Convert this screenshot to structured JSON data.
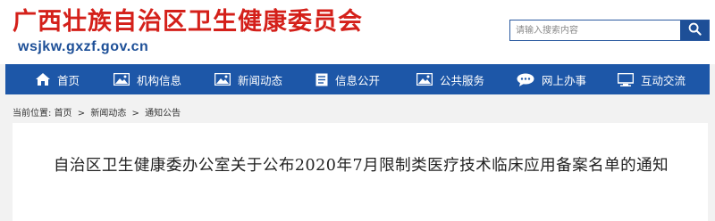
{
  "header": {
    "site_title": "广西壮族自治区卫生健康委员会",
    "site_url": "wsjkw.gxzf.gov.cn"
  },
  "search": {
    "placeholder": "请输入搜索内容",
    "icon": "search-icon"
  },
  "nav": {
    "items": [
      {
        "label": "首页",
        "icon": "home-icon"
      },
      {
        "label": "机构信息",
        "icon": "image-icon"
      },
      {
        "label": "新闻动态",
        "icon": "image-icon"
      },
      {
        "label": "信息公开",
        "icon": "document-icon"
      },
      {
        "label": "公共服务",
        "icon": "image-icon"
      },
      {
        "label": "网上办事",
        "icon": "chat-icon"
      },
      {
        "label": "互动交流",
        "icon": "monitor-icon"
      }
    ]
  },
  "breadcrumb": {
    "prefix": "当前位置:",
    "items": [
      "首页",
      "新闻动态",
      "通知公告"
    ],
    "separator": ">"
  },
  "article": {
    "title": "自治区卫生健康委办公室关于公布2020年7月限制类医疗技术临床应用备案名单的通知"
  },
  "colors": {
    "brand_red": "#d4201a",
    "brand_blue": "#1d57a8",
    "page_bg": "#f2f2f2"
  }
}
